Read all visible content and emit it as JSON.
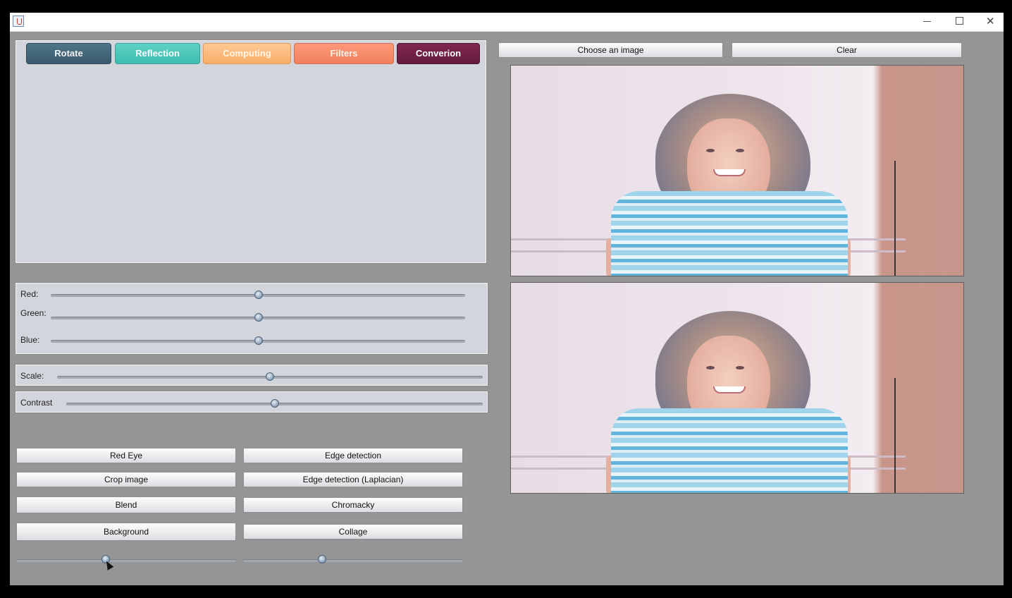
{
  "window": {
    "minimize_glyph": "",
    "maximize_glyph": "",
    "close_glyph": "✕"
  },
  "tabs": [
    {
      "label": "Rotate"
    },
    {
      "label": "Reflection"
    },
    {
      "label": "Computing"
    },
    {
      "label": "Filters"
    },
    {
      "label": "Converion"
    }
  ],
  "rgb": {
    "red_label": "Red:",
    "green_label": "Green:",
    "blue_label": "Blue:",
    "red_value": 0.5,
    "green_value": 0.5,
    "blue_value": 0.5
  },
  "scale": {
    "label": "Scale:",
    "value": 0.5
  },
  "contrast": {
    "label": "Contrast",
    "value": 0.5
  },
  "actions": {
    "red_eye": "Red Eye",
    "edge_detection": "Edge detection",
    "crop_image": "Crop image",
    "edge_laplacian": "Edge detection (Laplacian)",
    "blend": "Blend",
    "chromacky": "Chromacky",
    "background": "Background",
    "collage": "Collage"
  },
  "bottom_sliders": {
    "left_value": 0.4,
    "right_value": 0.36
  },
  "toolbar": {
    "choose_image": "Choose an image",
    "clear": "Clear"
  },
  "colors": {
    "window_bg": "#959595",
    "panel_bg": "#d3d5dc",
    "tab_rotate": "#3f6072",
    "tab_reflection": "#45c3b4",
    "tab_computing": "#fbb87a",
    "tab_filters": "#f88869",
    "tab_conversion": "#6e1d43"
  }
}
